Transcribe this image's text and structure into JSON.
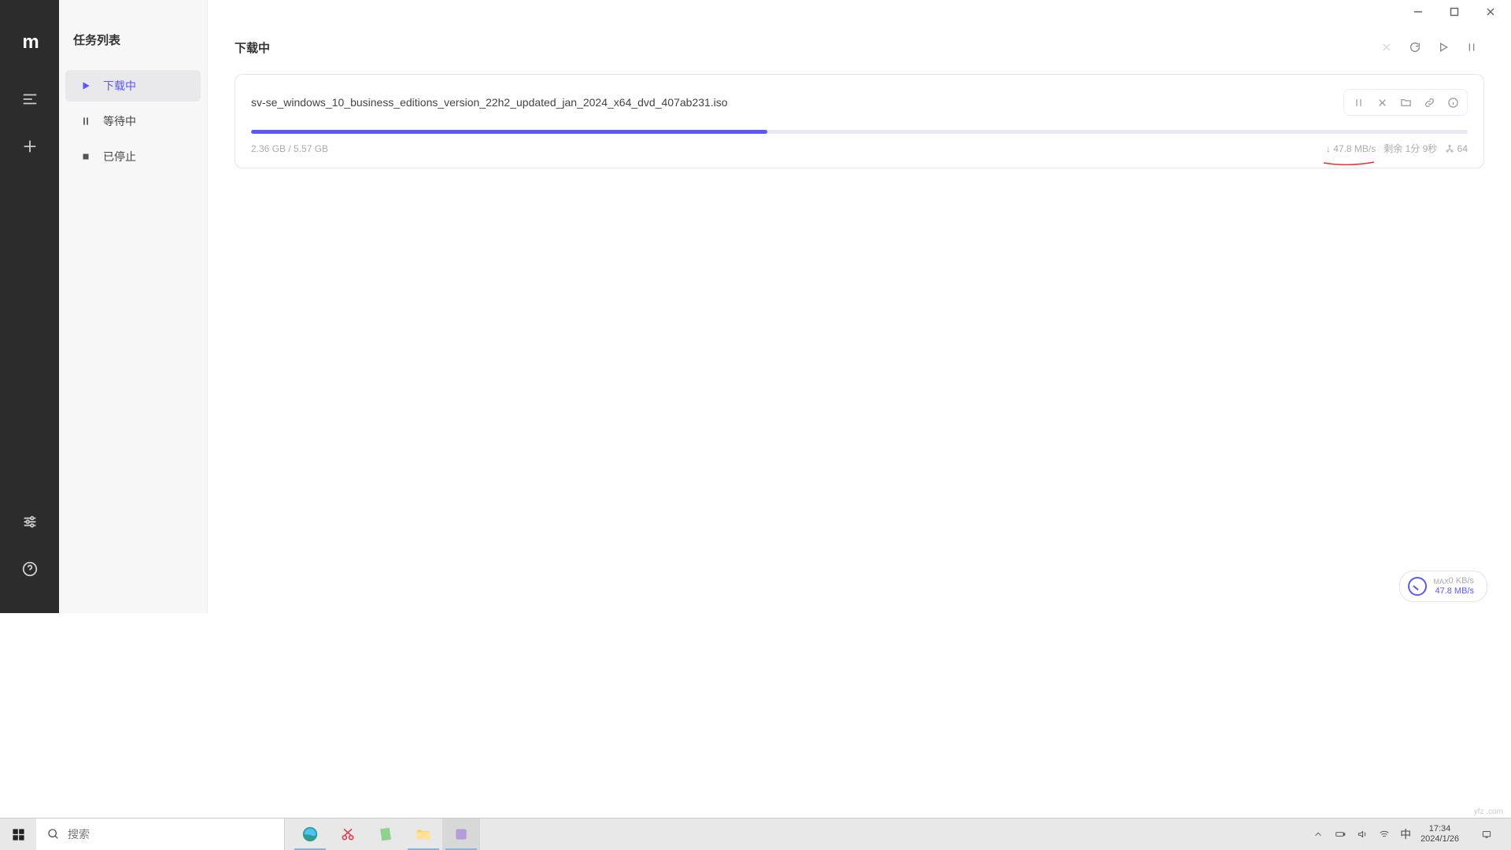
{
  "sidebar": {
    "title": "任务列表",
    "items": [
      {
        "label": "下载中",
        "active": true
      },
      {
        "label": "等待中",
        "active": false
      },
      {
        "label": "已停止",
        "active": false
      }
    ]
  },
  "main": {
    "title": "下载中"
  },
  "download": {
    "filename": "sv-se_windows_10_business_editions_version_22h2_updated_jan_2024_x64_dvd_407ab231.iso",
    "done": "2.36 GB",
    "total": "5.57 GB",
    "size_text": "2.36 GB / 5.57 GB",
    "progress_percent": 42.4,
    "speed": "47.8 MB/s",
    "remaining_label": "剩余",
    "remaining": "1分 9秒",
    "connections": "64"
  },
  "speed_badge": {
    "max_label": "MAX",
    "up": "0 KB/s",
    "down": "47.8 MB/s"
  },
  "taskbar": {
    "search_placeholder": "搜索",
    "ime": "中",
    "time": "17:34",
    "date": "2024/1/26"
  },
  "watermark": "yfz .com"
}
